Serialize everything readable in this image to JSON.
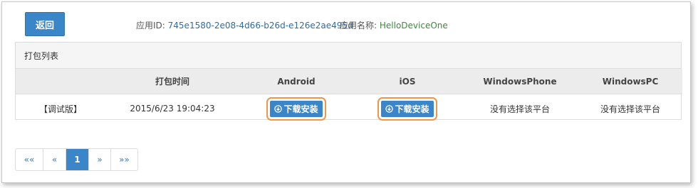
{
  "header": {
    "back_label": "返回",
    "app_id_label": "应用ID:",
    "app_id_value": "745e1580-2e08-4d66-b26d-e126e2ae495d",
    "app_name_label": "应用名称:",
    "app_name_value": "HelloDeviceOne"
  },
  "panel": {
    "title": "打包列表",
    "columns": [
      "",
      "打包时间",
      "Android",
      "iOS",
      "WindowsPhone",
      "WindowsPC"
    ],
    "rows": [
      {
        "version": "【调试版】",
        "time": "2015/6/23 19:04:23",
        "android": "下载安装",
        "ios": "下载安装",
        "windowsphone": "没有选择该平台",
        "windowspc": "没有选择该平台"
      }
    ]
  },
  "pagination": {
    "first": "««",
    "prev": "«",
    "current": "1",
    "next": "»",
    "last": "»»"
  },
  "colors": {
    "primary": "#3a86c8",
    "highlight": "#f0954a",
    "app_id": "#2e6ca4",
    "app_name": "#3d8a3d"
  },
  "icons": {
    "download": "download-circle-icon"
  }
}
